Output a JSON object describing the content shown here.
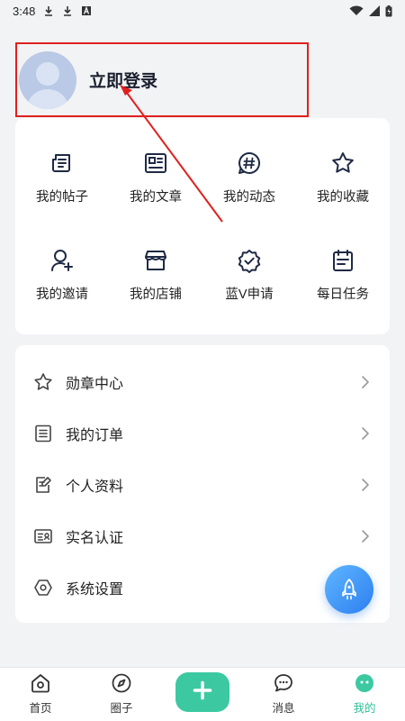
{
  "status_bar": {
    "time": "3:48"
  },
  "profile": {
    "login_label": "立即登录"
  },
  "grid": {
    "items": [
      {
        "label": "我的帖子",
        "icon": "post-icon"
      },
      {
        "label": "我的文章",
        "icon": "article-icon"
      },
      {
        "label": "我的动态",
        "icon": "hashtag-icon"
      },
      {
        "label": "我的收藏",
        "icon": "star-icon"
      },
      {
        "label": "我的邀请",
        "icon": "invite-user-icon"
      },
      {
        "label": "我的店铺",
        "icon": "store-icon"
      },
      {
        "label": "蓝V申请",
        "icon": "verified-badge-icon"
      },
      {
        "label": "每日任务",
        "icon": "calendar-task-icon"
      }
    ]
  },
  "menu": {
    "items": [
      {
        "label": "勋章中心",
        "icon": "star-outline-icon"
      },
      {
        "label": "我的订单",
        "icon": "order-list-icon"
      },
      {
        "label": "个人资料",
        "icon": "edit-document-icon"
      },
      {
        "label": "实名认证",
        "icon": "id-card-icon"
      },
      {
        "label": "系统设置",
        "icon": "settings-hex-icon"
      }
    ]
  },
  "tabbar": {
    "tabs": [
      {
        "label": "首页",
        "icon": "home-icon"
      },
      {
        "label": "圈子",
        "icon": "compass-icon"
      },
      {
        "label": "",
        "icon": "plus-icon"
      },
      {
        "label": "消息",
        "icon": "chat-bubble-icon"
      },
      {
        "label": "我的",
        "icon": "profile-face-icon"
      }
    ]
  },
  "colors": {
    "accent": "#2bbf97",
    "annotation": "#e0201e",
    "fab": "#2d7ff0"
  }
}
